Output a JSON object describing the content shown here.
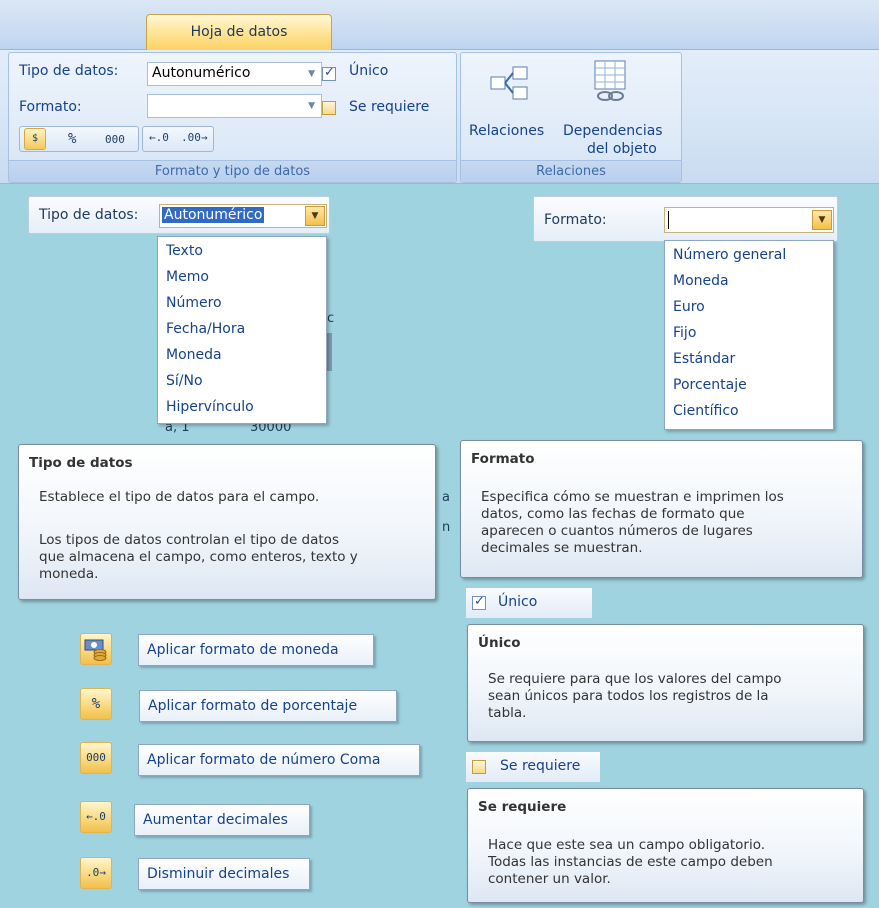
{
  "ribbon": {
    "tab_label": "Hoja de datos",
    "tipo_label": "Tipo de datos:",
    "tipo_value": "Autonumérico",
    "formato_label": "Formato:",
    "formato_value": "",
    "unico_label": "Único",
    "unico_checked": true,
    "se_requiere_label": "Se requiere",
    "se_requiere_checked": false,
    "currency_icon": "currency-icon",
    "percent_glyph": "%",
    "thousands_glyph": "000",
    "increase_dec_icon": "increase-decimals-icon",
    "decrease_dec_icon": "decrease-decimals-icon",
    "group1_label": "Formato y tipo de datos",
    "relaciones_label": "Relaciones",
    "dependencias_line1": "Dependencias",
    "dependencias_line2": "del objeto",
    "group2_label": "Relaciones"
  },
  "tipo_dropdown": {
    "label": "Tipo de datos:",
    "value": "Autonumérico",
    "options": [
      "Texto",
      "Memo",
      "Número",
      "Fecha/Hora",
      "Moneda",
      "Sí/No",
      "Hipervínculo"
    ]
  },
  "formato_dropdown": {
    "label": "Formato:",
    "value": "",
    "options": [
      "Número general",
      "Moneda",
      "Euro",
      "Fijo",
      "Estándar",
      "Porcentaje",
      "Científico"
    ]
  },
  "tooltips": {
    "tipo": {
      "title": "Tipo de datos",
      "line1": "Establece el tipo de datos para el campo.",
      "line2": "Los tipos de datos controlan el tipo de datos",
      "line3": "que almacena el campo, como enteros, texto y",
      "line4": "moneda."
    },
    "formato": {
      "title": "Formato",
      "line1": "Especifica cómo se muestran e imprimen los",
      "line2": "datos, como las fechas de formato que",
      "line3": "aparecen o cuantos números de lugares",
      "line4": "decimales se muestran."
    },
    "unico": {
      "title": "Único",
      "line1": "Se requiere para que los valores del campo",
      "line2": "sean únicos para todos los registros de la",
      "line3": "tabla."
    },
    "se_requiere": {
      "title": "Se requiere",
      "line1": "Hace que este sea un campo obligatorio.",
      "line2": "Todas las instancias de este campo deben",
      "line3": "contener un valor."
    }
  },
  "checks": {
    "unico_label": "Único",
    "se_requiere_label": "Se requiere"
  },
  "commands": [
    {
      "icon": "currency-icon",
      "glyph": "",
      "label": "Aplicar formato de moneda"
    },
    {
      "icon": "percent-icon",
      "glyph": "%",
      "label": "Aplicar formato de porcentaje"
    },
    {
      "icon": "comma-number-icon",
      "glyph": "000",
      "label": "Aplicar formato de número Coma"
    },
    {
      "icon": "increase-decimals-icon",
      "glyph": "",
      "label": "Aumentar decimales"
    },
    {
      "icon": "decrease-decimals-icon",
      "glyph": "",
      "label": "Disminuir decimales"
    }
  ],
  "background_fragments": [
    "c",
    "a, 1",
    "30000",
    "a",
    "n"
  ]
}
